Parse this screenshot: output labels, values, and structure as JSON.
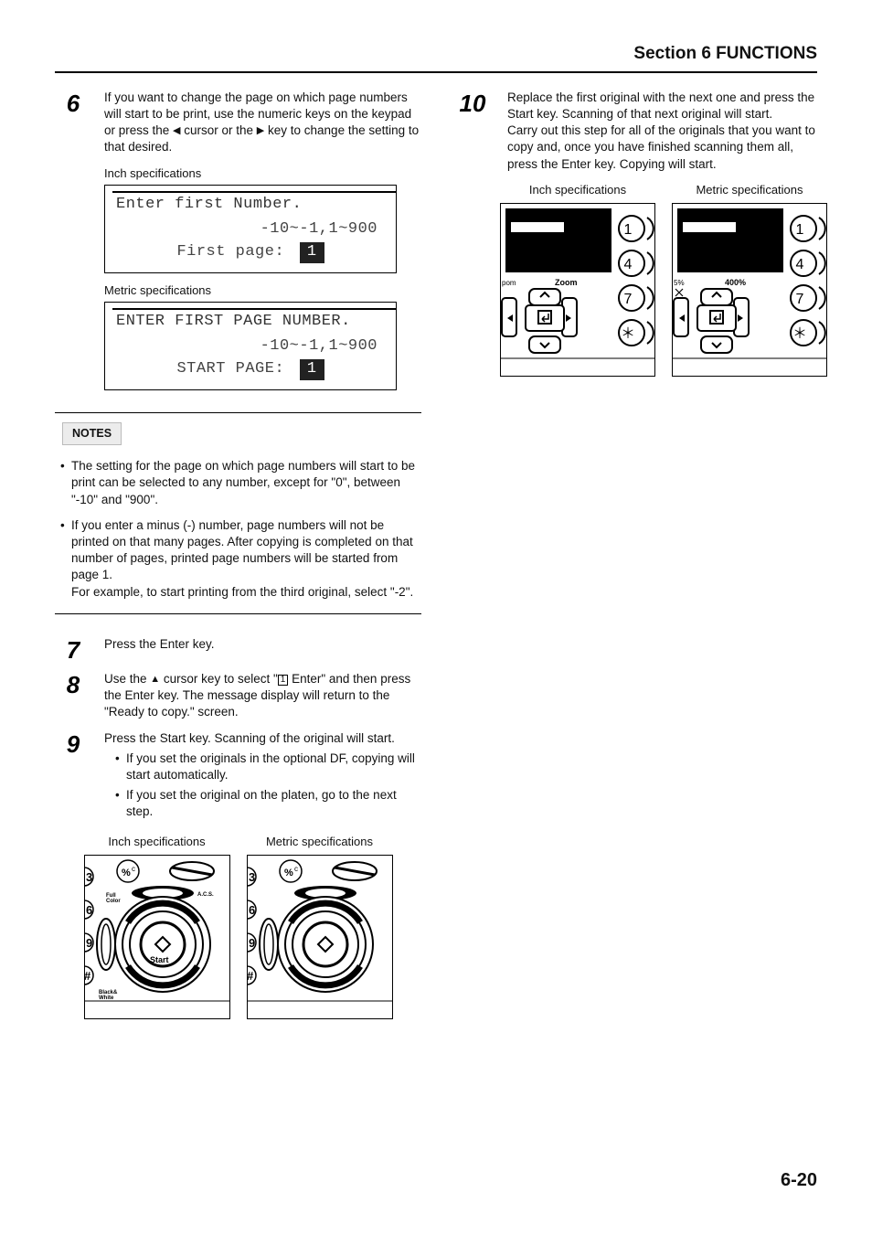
{
  "header": {
    "title": "Section 6  FUNCTIONS"
  },
  "left": {
    "step6": {
      "num": "6",
      "text_a": "If you want to change the page on which page numbers will start to be print, use the numeric keys on the keypad or press the ",
      "text_b": " cursor or the ",
      "text_c": " key to change the setting to that desired."
    },
    "lcd_inch_label": "Inch specifications",
    "lcd_inch": {
      "line1": "Enter first Number.",
      "line2": "-10~-1,1~900",
      "line3_label": "First page:",
      "line3_value": "1"
    },
    "lcd_metric_label": "Metric specifications",
    "lcd_metric": {
      "line1": "ENTER FIRST PAGE NUMBER.",
      "line2": "-10~-1,1~900",
      "line3_label": "START PAGE:",
      "line3_value": "1"
    },
    "notes_title": "NOTES",
    "notes": [
      "The setting for the page on which page numbers will start to be print can be selected to any number, except for \"0\", between \"-10\" and \"900\".",
      "If you enter a minus (-) number, page numbers will not be printed on that many pages. After copying is completed on that number of pages, printed page numbers will be started from page 1.\nFor example, to start printing from the third original, select  \"-2\"."
    ],
    "step7": {
      "num": "7",
      "text": "Press the Enter key."
    },
    "step8": {
      "num": "8",
      "text_a": "Use the ",
      "text_b": " cursor key to select \"",
      "text_c": " Enter\" and then press the Enter key. The message display will return to the \"Ready to copy.\" screen."
    },
    "step9": {
      "num": "9",
      "text": "Press the Start key. Scanning of the original will start.",
      "bullets": [
        "If you set the originals in the optional DF, copying will start automatically.",
        "If you set the original on the platen, go to the next step."
      ]
    },
    "panel9": {
      "inch_label": "Inch specifications",
      "metric_label": "Metric specifications",
      "labels": {
        "full_color": "Full\nColor",
        "acs": "A.C.S.",
        "start": "Start",
        "bw": "Black&\nWhite"
      }
    }
  },
  "right": {
    "step10": {
      "num": "10",
      "text": "Replace the first original with the next one and press the Start key. Scanning of that next original will start.\nCarry out this step for all of the originals that you want to copy and, once you have finished scanning them all, press the Enter key. Copying will start."
    },
    "panel10": {
      "inch_label": "Inch specifications",
      "metric_label": "Metric specifications",
      "zoom_inch": "Zoom",
      "zoom_prefix_inch": "pom",
      "pct_metric": "5%",
      "pct_right_metric": "400%"
    },
    "keypad": [
      "1",
      "4",
      "7",
      "＊"
    ]
  },
  "page_number": "6-20"
}
